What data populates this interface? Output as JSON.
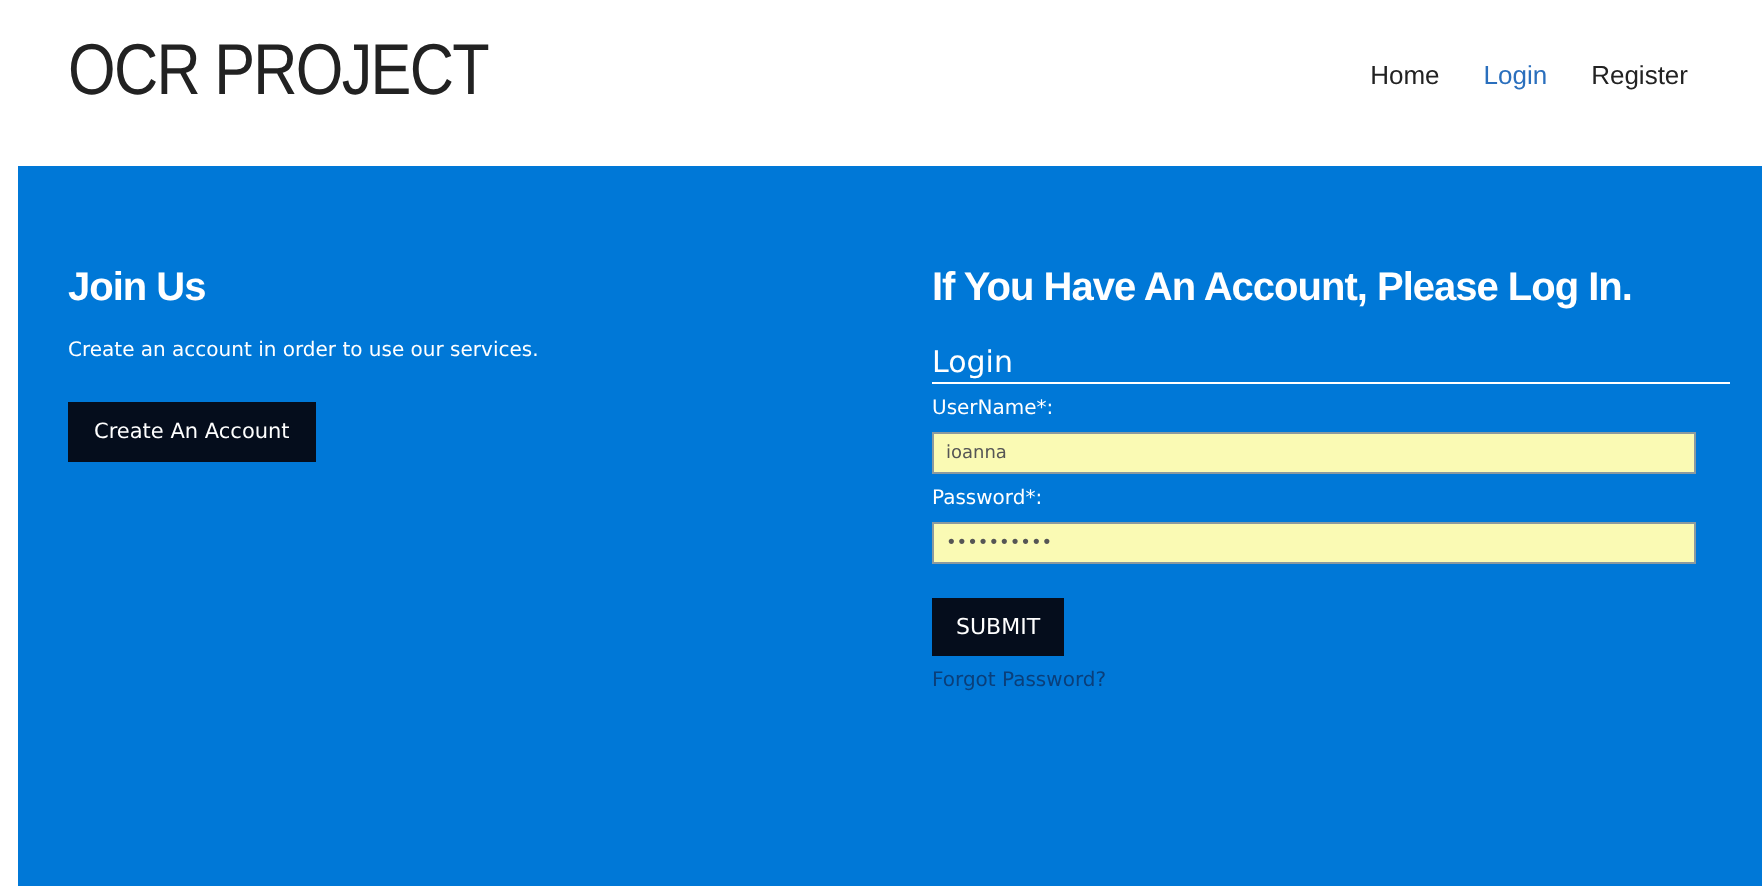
{
  "header": {
    "logo": "OCR PROJECT",
    "nav": [
      {
        "label": "Home",
        "selected": false
      },
      {
        "label": "Login",
        "selected": true
      },
      {
        "label": "Register",
        "selected": false
      }
    ]
  },
  "join": {
    "title": "Join Us",
    "text": "Create an account in order to use our services.",
    "button": "Create An Account"
  },
  "login": {
    "title": "If You Have An Account, Please Log In.",
    "legend": "Login",
    "fields": [
      {
        "label": "UserName*:",
        "value": "ioanna"
      },
      {
        "label": "Password*:",
        "value": "••••••••••"
      }
    ],
    "submit": "SUBMIT",
    "forgot": "Forgot Password?"
  }
}
